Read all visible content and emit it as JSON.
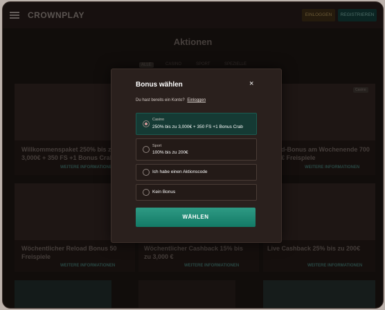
{
  "header": {
    "logo": "CROWNPLAY",
    "login_label": "EINLOGGEN",
    "register_label": "REGISTRIEREN"
  },
  "page": {
    "title": "Aktionen",
    "tabs": [
      {
        "label": "Alle",
        "active": true
      },
      {
        "label": "Casino",
        "active": false
      },
      {
        "label": "Sport",
        "active": false
      },
      {
        "label": "Spezielle",
        "active": false
      }
    ]
  },
  "promos": [
    {
      "title": "Willkommenspaket 250% bis zu 3,000€ + 350 FS +1 Bonus Crab",
      "more": "WEITERE INFORMATIONEN"
    },
    {
      "title": "d-Bonus am Wochenende 700 € Freispiele",
      "more": "WEITERE INFORMATIONEN",
      "badge": "Casino"
    },
    {
      "title": "Wöchentlicher Reload Bonus 50 Freispiele",
      "more": "WEITERE INFORMATIONEN"
    },
    {
      "title": "Wöchentlicher Cashback 15% bis zu 3,000 €",
      "more": "WEITERE INFORMATIONEN"
    },
    {
      "title": "Live Cashback 25% bis zu 200€",
      "more": "WEITERE INFORMATIONEN"
    }
  ],
  "modal": {
    "title": "Bonus wählen",
    "close": "×",
    "account_question": "Du hast bereits ein Konto?",
    "login_link": "Einloggen",
    "options": [
      {
        "category": "Casino",
        "label": "250% bis zu 3,000€ + 350 FS +1 Bonus Crab",
        "selected": true
      },
      {
        "category": "Sport",
        "label": "100% bis zu 200€",
        "selected": false
      },
      {
        "category": "",
        "label": "Ich habe einen Aktionscode",
        "selected": false
      },
      {
        "category": "",
        "label": "Kein Bonus",
        "selected": false
      }
    ],
    "submit_label": "WÄHLEN"
  },
  "colors": {
    "accent": "#1c8a74",
    "background": "#1b1412"
  }
}
